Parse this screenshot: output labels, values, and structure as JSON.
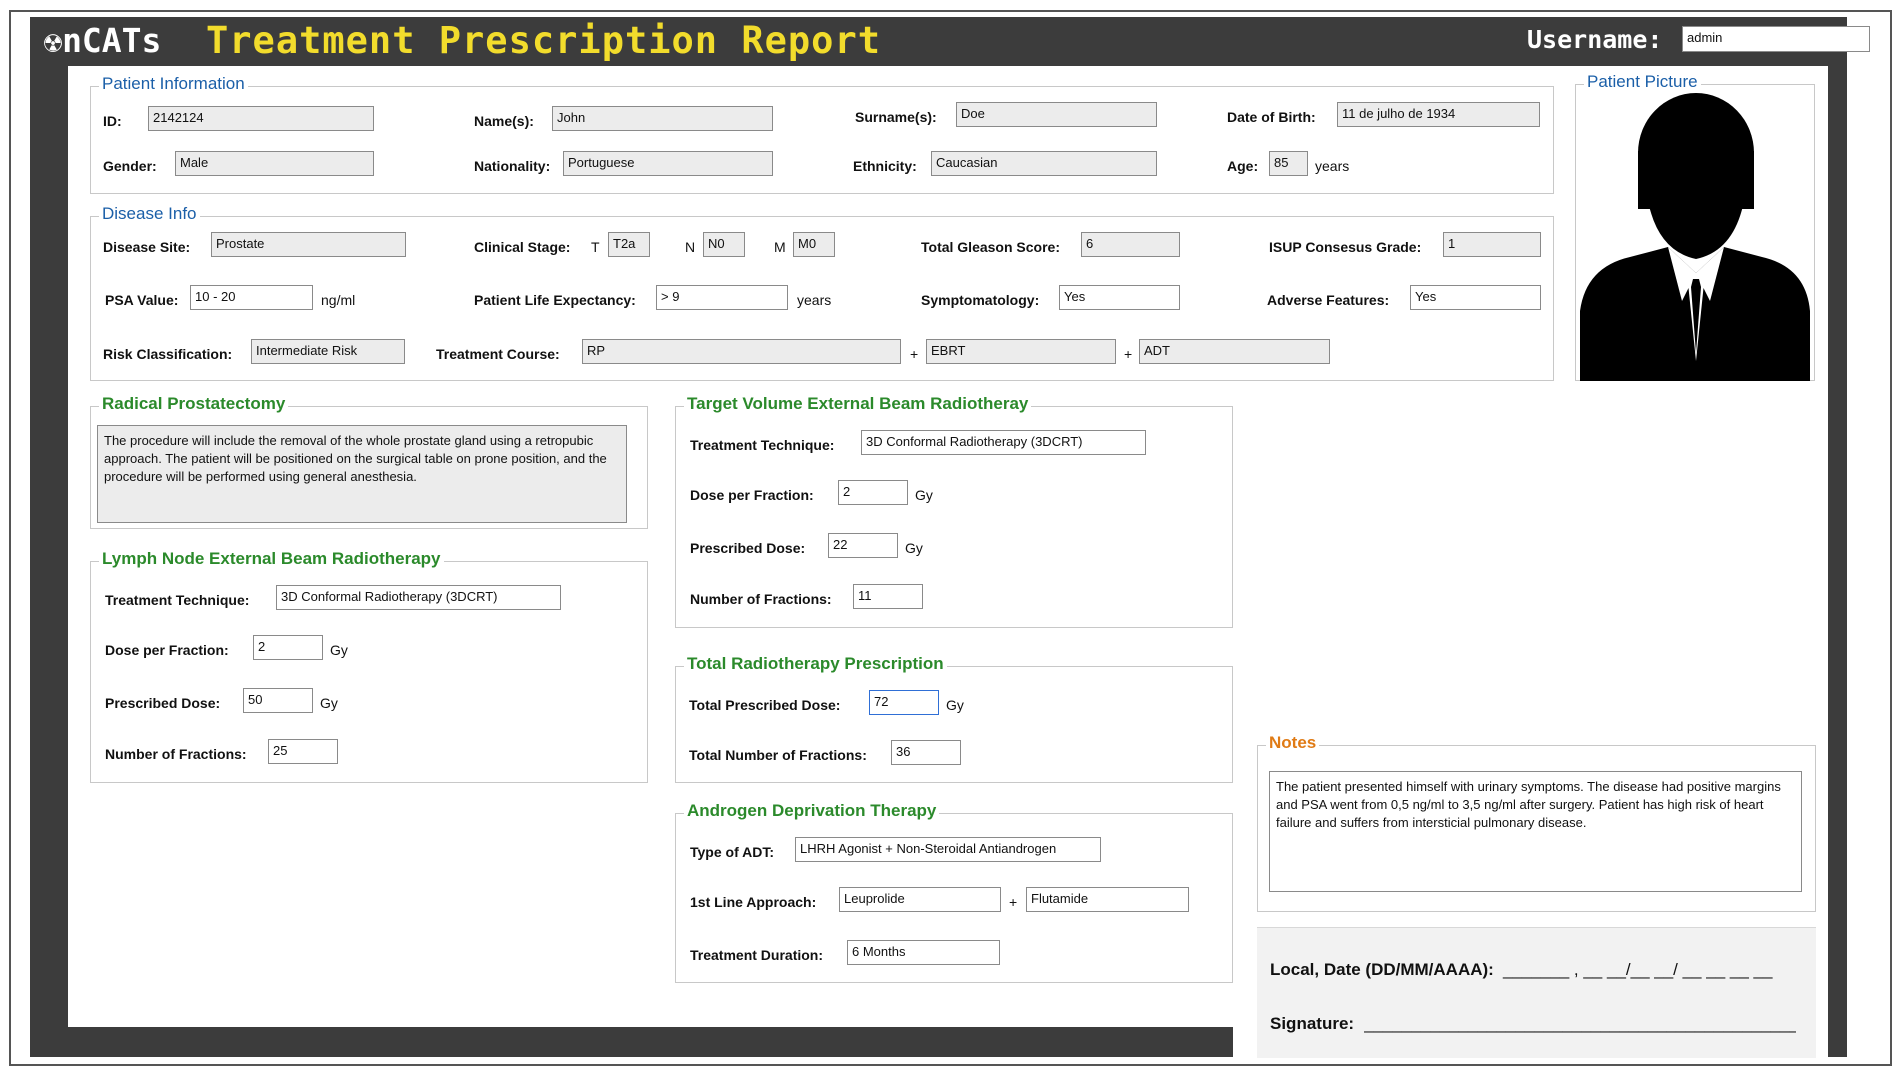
{
  "header": {
    "logo_symbol": "☢",
    "logo_text": "nCATs",
    "title": "Treatment Prescription Report",
    "username_label": "Username:",
    "username_value": "admin"
  },
  "patient_info": {
    "legend": "Patient Information",
    "id_label": "ID:",
    "id_value": "2142124",
    "name_label": "Name(s):",
    "name_value": "John",
    "surname_label": "Surname(s):",
    "surname_value": "Doe",
    "dob_label": "Date of Birth:",
    "dob_value": "11 de julho de 1934",
    "gender_label": "Gender:",
    "gender_value": "Male",
    "nationality_label": "Nationality:",
    "nationality_value": "Portuguese",
    "ethnicity_label": "Ethnicity:",
    "ethnicity_value": "Caucasian",
    "age_label": "Age:",
    "age_value": "85",
    "age_unit": "years"
  },
  "patient_picture": {
    "legend": "Patient Picture",
    "icon": "person-silhouette-icon"
  },
  "disease_info": {
    "legend": "Disease Info",
    "site_label": "Disease Site:",
    "site_value": "Prostate",
    "stage_label": "Clinical Stage:",
    "t_label": "T",
    "t_value": "T2a",
    "n_label": "N",
    "n_value": "N0",
    "m_label": "M",
    "m_value": "M0",
    "gleason_label": "Total Gleason Score:",
    "gleason_value": "6",
    "isup_label": "ISUP Consesus Grade:",
    "isup_value": "1",
    "psa_label": "PSA Value:",
    "psa_value": "10 - 20",
    "psa_unit": "ng/ml",
    "life_label": "Patient Life Expectancy:",
    "life_value": "> 9",
    "life_unit": "years",
    "symptom_label": "Symptomatology:",
    "symptom_value": "Yes",
    "adverse_label": "Adverse Features:",
    "adverse_value": "Yes",
    "risk_label": "Risk Classification:",
    "risk_value": "Intermediate Risk",
    "course_label": "Treatment Course:",
    "course_1": "RP",
    "plus_1": "+",
    "course_2": "EBRT",
    "plus_2": "+",
    "course_3": "ADT"
  },
  "radical": {
    "legend": "Radical Prostatectomy",
    "text": "The procedure will include the removal of the whole prostate gland using a retropubic approach. The patient will be positioned on the surgical table on prone position, and the procedure will be performed using general anesthesia."
  },
  "lymph": {
    "legend": "Lymph Node External Beam Radiotherapy",
    "technique_label": "Treatment Technique:",
    "technique_value": "3D Conformal Radiotherapy (3DCRT)",
    "dose_fraction_label": "Dose per Fraction:",
    "dose_fraction_value": "2",
    "dose_fraction_unit": "Gy",
    "prescribed_label": "Prescribed Dose:",
    "prescribed_value": "50",
    "prescribed_unit": "Gy",
    "fractions_label": "Number of Fractions:",
    "fractions_value": "25"
  },
  "target": {
    "legend": "Target Volume External Beam Radiotheray",
    "technique_label": "Treatment Technique:",
    "technique_value": "3D Conformal Radiotherapy (3DCRT)",
    "dose_fraction_label": "Dose per Fraction:",
    "dose_fraction_value": "2",
    "dose_fraction_unit": "Gy",
    "prescribed_label": "Prescribed Dose:",
    "prescribed_value": "22",
    "prescribed_unit": "Gy",
    "fractions_label": "Number of Fractions:",
    "fractions_value": "11"
  },
  "total_rt": {
    "legend": "Total Radiotherapy Prescription",
    "dose_label": "Total Prescribed Dose:",
    "dose_value": "72",
    "dose_unit": "Gy",
    "fractions_label": "Total Number of Fractions:",
    "fractions_value": "36"
  },
  "adt": {
    "legend": "Androgen Deprivation Therapy",
    "type_label": "Type of ADT:",
    "type_value": "LHRH Agonist + Non-Steroidal Antiandrogen",
    "approach_label": "1st Line Approach:",
    "approach_1": "Leuprolide",
    "plus": "+",
    "approach_2": "Flutamide",
    "duration_label": "Treatment Duration:",
    "duration_value": "6 Months"
  },
  "notes": {
    "legend": "Notes",
    "text": "The patient presented himself with urinary symptoms. The disease had positive margins and PSA went from 0,5 ng/ml to 3,5 ng/ml after surgery. Patient has high risk of heart failure and suffers from intersticial pulmonary disease."
  },
  "signature": {
    "date_label": "Local, Date (DD/MM/AAAA):",
    "date_blank": "_______ , __ __/__ __/ __ __ __ __",
    "signature_label": "Signature:",
    "signature_line": "______________________________________________"
  }
}
